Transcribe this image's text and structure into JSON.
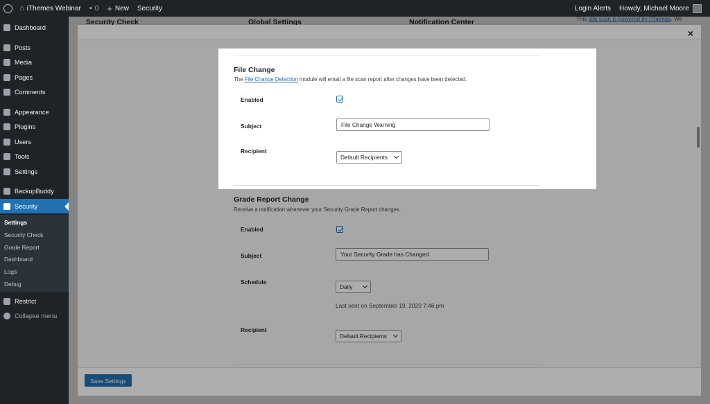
{
  "adminbar": {
    "site_name": "iThemes Webinar",
    "comments_count": "0",
    "new_label": "New",
    "security_label": "Security",
    "login_alerts": "Login Alerts",
    "howdy": "Howdy, Michael Moore"
  },
  "menu": {
    "dashboard": "Dashboard",
    "posts": "Posts",
    "media": "Media",
    "pages": "Pages",
    "comments": "Comments",
    "appearance": "Appearance",
    "plugins": "Plugins",
    "users": "Users",
    "tools": "Tools",
    "settings": "Settings",
    "backupbuddy": "BackupBuddy",
    "security": "Security",
    "restrict": "Restrict",
    "collapse": "Collapse menu",
    "submenu": [
      "Settings",
      "Security Check",
      "Grade Report",
      "Dashboard",
      "Logs",
      "Debug"
    ]
  },
  "background": {
    "card1": "Security Check",
    "card2": "Global Settings",
    "card3": "Notification Center",
    "note_prefix": "This ",
    "note_link": "site scan is powered by iThemes",
    "note_suffix": ". We"
  },
  "modal": {
    "close": "×",
    "save_button": "Save Settings",
    "file_change": {
      "title": "File Change",
      "desc_prefix": "The ",
      "desc_link": "File Change Detection",
      "desc_suffix": " module will email a file scan report after changes have been detected.",
      "enabled_label": "Enabled",
      "subject_label": "Subject",
      "subject_value": "File Change Warning",
      "recipient_label": "Recipient",
      "recipient_value": "Default Recipients"
    },
    "grade_report": {
      "title": "Grade Report Change",
      "desc": "Receive a notification whenever your Security Grade Report changes.",
      "enabled_label": "Enabled",
      "subject_label": "Subject",
      "subject_value": "Your Security Grade has Changed",
      "schedule_label": "Schedule",
      "schedule_value": "Daily",
      "last_sent": "Last sent on September 19, 2020 7:46 pm",
      "recipient_label": "Recipient",
      "recipient_value": "Default Recipients"
    }
  }
}
